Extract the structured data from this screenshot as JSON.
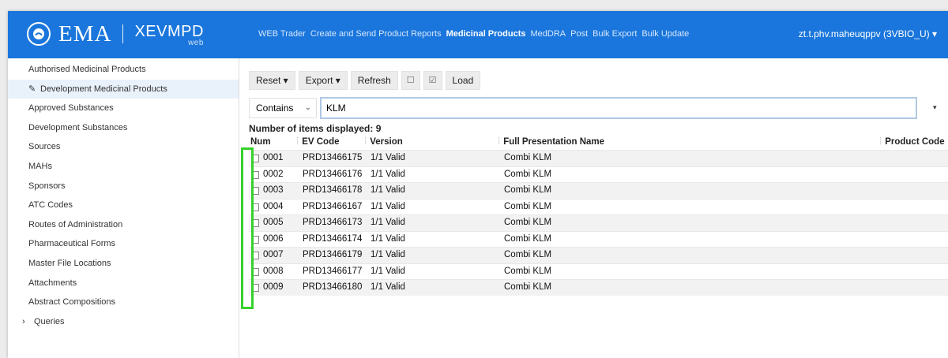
{
  "app": {
    "logo_text": "EMA",
    "product_name": "XEVMPD",
    "product_sub": "web",
    "user": "zt.t.phv.maheuqppv (3VBIO_U) ▾"
  },
  "nav": {
    "items": [
      "WEB Trader",
      "Create and Send Product Reports",
      "Medicinal Products",
      "MedDRA",
      "Post",
      "Bulk Export",
      "Bulk Update"
    ],
    "active": "Medicinal Products"
  },
  "sidebar": {
    "items": [
      {
        "label": "Authorised Medicinal Products"
      },
      {
        "label": "Development Medicinal Products",
        "icon": "pencil-icon"
      },
      {
        "label": "Approved Substances"
      },
      {
        "label": "Development Substances"
      },
      {
        "label": "Sources"
      },
      {
        "label": "MAHs"
      },
      {
        "label": "Sponsors"
      },
      {
        "label": "ATC Codes"
      },
      {
        "label": "Routes of Administration"
      },
      {
        "label": "Pharmaceutical Forms"
      },
      {
        "label": "Master File Locations"
      },
      {
        "label": "Attachments"
      },
      {
        "label": "Abstract Compositions"
      },
      {
        "label": "Queries",
        "icon": "chevron-right-icon"
      }
    ]
  },
  "toolbar": {
    "reset": "Reset ▾",
    "export": "Export ▾",
    "refresh": "Refresh",
    "uncheck_all": "☐",
    "check_all": "☑",
    "load": "Load"
  },
  "filter": {
    "operator": "Contains",
    "chevron": "⌄",
    "value": "KLM",
    "dropdown": "▾"
  },
  "table": {
    "count_label": "Number of items displayed: 9",
    "headers": [
      "Num",
      "EV Code",
      "Version",
      "Full Presentation Name",
      "Product Code"
    ],
    "rows": [
      {
        "num": "0001",
        "ev": "PRD13466175",
        "version": "1/1 Valid",
        "name": "Combi KLM",
        "code": ""
      },
      {
        "num": "0002",
        "ev": "PRD13466176",
        "version": "1/1 Valid",
        "name": "Combi KLM",
        "code": ""
      },
      {
        "num": "0003",
        "ev": "PRD13466178",
        "version": "1/1 Valid",
        "name": "Combi KLM",
        "code": ""
      },
      {
        "num": "0004",
        "ev": "PRD13466167",
        "version": "1/1 Valid",
        "name": "Combi KLM",
        "code": ""
      },
      {
        "num": "0005",
        "ev": "PRD13466173",
        "version": "1/1 Valid",
        "name": "Combi KLM",
        "code": ""
      },
      {
        "num": "0006",
        "ev": "PRD13466174",
        "version": "1/1 Valid",
        "name": "Combi KLM",
        "code": ""
      },
      {
        "num": "0007",
        "ev": "PRD13466179",
        "version": "1/1 Valid",
        "name": "Combi KLM",
        "code": ""
      },
      {
        "num": "0008",
        "ev": "PRD13466177",
        "version": "1/1 Valid",
        "name": "Combi KLM",
        "code": ""
      },
      {
        "num": "0009",
        "ev": "PRD13466180",
        "version": "1/1 Valid",
        "name": "Combi KLM",
        "code": ""
      }
    ]
  },
  "colors": {
    "topbar": "#1a76dc",
    "highlight": "#35d12c",
    "selected_sidebar": "#e9f1fb"
  }
}
